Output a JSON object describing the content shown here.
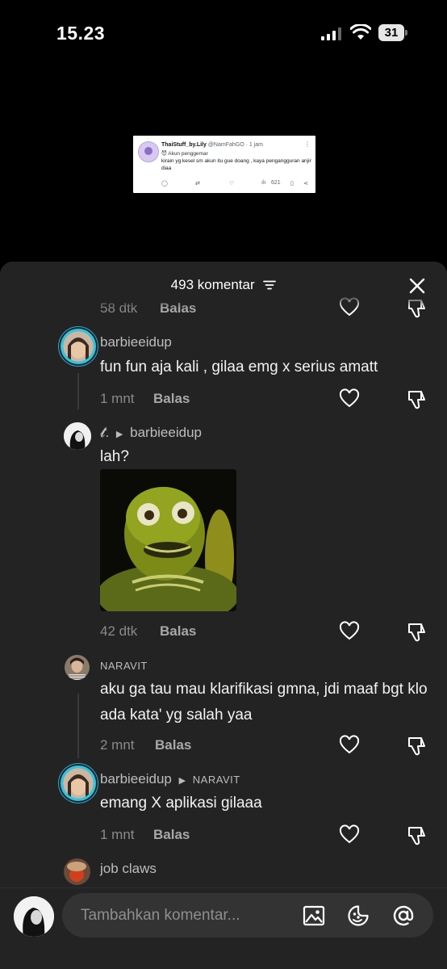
{
  "status": {
    "time": "15.23",
    "battery": "31"
  },
  "tweet": {
    "name": "ThaiStuff_by.Lily",
    "handle": "@NamFahGO",
    "time": "· 1 jam",
    "badge": "Akun penggemar",
    "text": "kirain yg kesel sm akun itu gue doang , kaya pengangguran anjir diaa",
    "views": "621"
  },
  "sheet": {
    "title": "493 komentar",
    "input_placeholder": "Tambahkan komentar..."
  },
  "comments": [
    {
      "time": "58 dtk",
      "reply": "Balas"
    },
    {
      "user": "barbieeidup",
      "text": "fun fun aja kali , gilaa emg x serius amatt",
      "time": "1 mnt",
      "reply": "Balas"
    },
    {
      "user": "𝓽.",
      "reply_to": "barbieeidup",
      "text": "lah?",
      "time": "42 dtk",
      "reply": "Balas"
    },
    {
      "user": "NARAVIT",
      "text": "aku ga tau mau klarifikasi gmna, jdi maaf bgt klo ada kata' yg salah yaa",
      "time": "2 mnt",
      "reply": "Balas"
    },
    {
      "user": "barbieeidup",
      "reply_to": "NARAVIT",
      "text": "emang X aplikasi gilaaa",
      "time": "1 mnt",
      "reply": "Balas"
    },
    {
      "user": "job claws"
    }
  ],
  "icons": {
    "filter": "filter-icon",
    "close": "close-icon",
    "heart": "heart-icon",
    "dislike": "thumb-down-icon",
    "image": "image-icon",
    "emoji": "emoji-icon",
    "mention": "at-icon"
  },
  "colors": {
    "background": "#000000",
    "sheet": "#232323",
    "story_ring": "#27c8e8"
  }
}
